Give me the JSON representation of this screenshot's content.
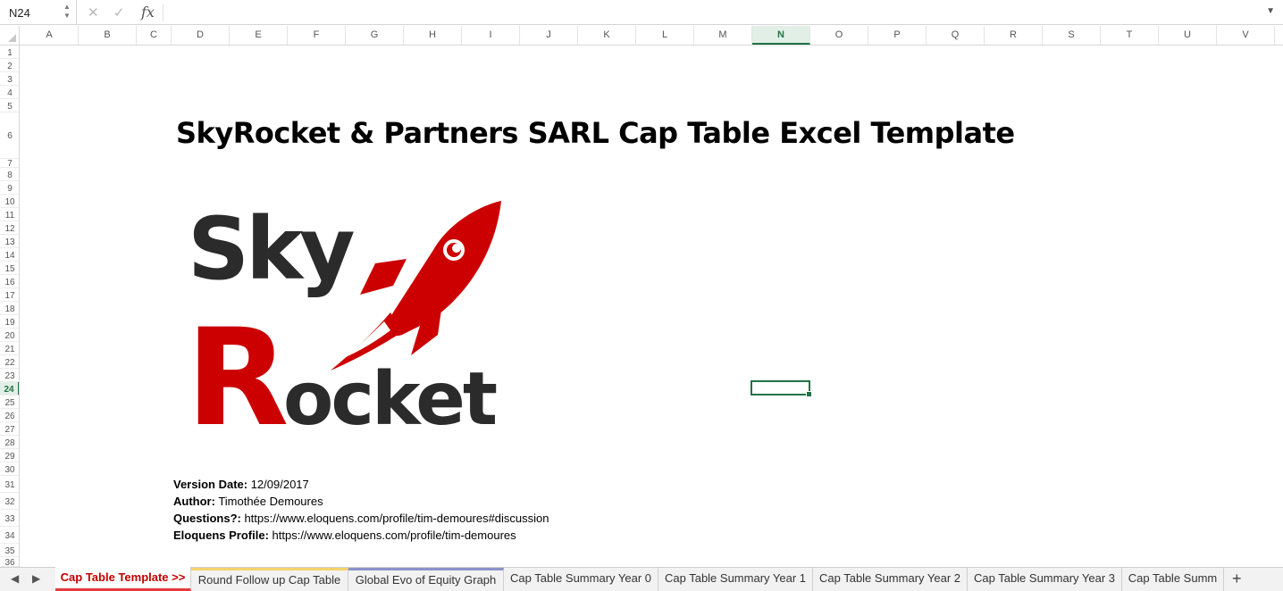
{
  "formula_bar": {
    "name_box": "N24",
    "cancel_icon": "x-icon",
    "confirm_icon": "check-icon",
    "fx_label": "fx",
    "formula": ""
  },
  "columns": [
    "A",
    "B",
    "C",
    "D",
    "E",
    "F",
    "G",
    "H",
    "I",
    "J",
    "K",
    "L",
    "M",
    "N",
    "O",
    "P",
    "Q",
    "R",
    "S",
    "T",
    "U",
    "V"
  ],
  "active_column": "N",
  "rows": [
    "1",
    "2",
    "3",
    "4",
    "5",
    "6",
    "7",
    "8",
    "9",
    "10",
    "11",
    "12",
    "13",
    "14",
    "15",
    "16",
    "17",
    "18",
    "19",
    "20",
    "21",
    "22",
    "23",
    "24",
    "25",
    "26",
    "27",
    "28",
    "29",
    "30",
    "31",
    "32",
    "33",
    "34",
    "35",
    "36"
  ],
  "active_row": "24",
  "sheet": {
    "title": "SkyRocket & Partners SARL Cap Table Excel Template",
    "logo_top": "Sky",
    "logo_bottom": "Rocket",
    "version_label": "Version Date:",
    "version_value": " 12/09/2017",
    "author_label": "Author:",
    "author_value": " Timothée Demoures",
    "questions_label": "Questions?:",
    "questions_value": " https://www.eloquens.com/profile/tim-demoures#discussion",
    "profile_label": "Eloquens Profile:",
    "profile_value": " https://www.eloquens.com/profile/tim-demoures"
  },
  "tabs": [
    {
      "label": "Cap Table Template >>",
      "state": "active"
    },
    {
      "label": "Round Follow up Cap Table",
      "state": "gold"
    },
    {
      "label": "Global Evo of Equity Graph",
      "state": "blue"
    },
    {
      "label": "Cap Table Summary Year 0",
      "state": ""
    },
    {
      "label": "Cap Table Summary Year 1",
      "state": ""
    },
    {
      "label": "Cap Table Summary Year 2",
      "state": ""
    },
    {
      "label": "Cap Table Summary Year 3",
      "state": ""
    },
    {
      "label": "Cap Table Summ",
      "state": ""
    }
  ],
  "colors": {
    "accent": "#217346",
    "logo_red": "#cc0000",
    "logo_dark": "#2b2b2b"
  }
}
